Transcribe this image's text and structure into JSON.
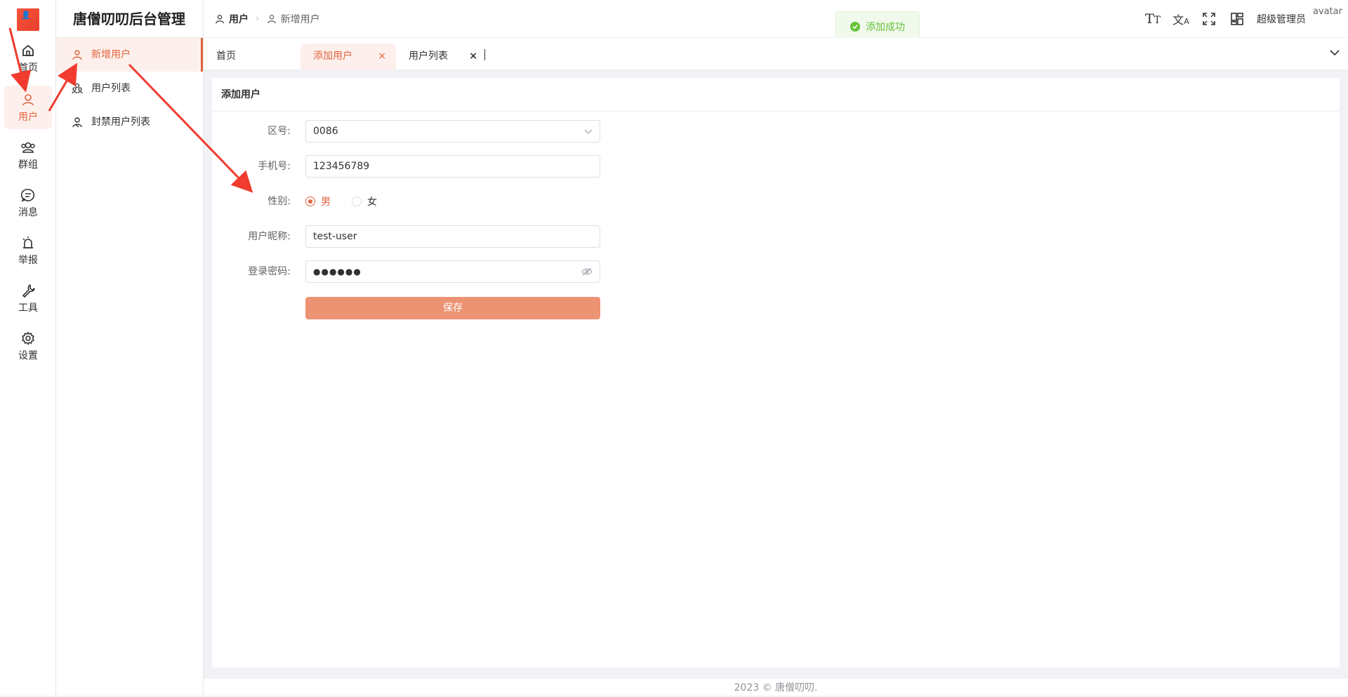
{
  "app": {
    "title": "唐僧叨叨后台管理"
  },
  "rail": {
    "items": [
      {
        "label": "首页",
        "icon": "home-icon"
      },
      {
        "label": "用户",
        "icon": "user-icon"
      },
      {
        "label": "群组",
        "icon": "group-icon"
      },
      {
        "label": "消息",
        "icon": "message-icon"
      },
      {
        "label": "举报",
        "icon": "alarm-icon"
      },
      {
        "label": "工具",
        "icon": "wrench-icon"
      },
      {
        "label": "设置",
        "icon": "gear-icon"
      }
    ]
  },
  "submenu": {
    "items": [
      {
        "label": "新增用户",
        "icon": "user-add-icon"
      },
      {
        "label": "用户列表",
        "icon": "users-icon"
      },
      {
        "label": "封禁用户列表",
        "icon": "user-ban-icon"
      }
    ]
  },
  "breadcrumb": {
    "level1": "用户",
    "level2": "新增用户"
  },
  "header": {
    "user_name": "超级管理员",
    "avatar_alt": "avatar"
  },
  "tabs": [
    {
      "label": "首页"
    },
    {
      "label": "添加用户",
      "close": "×"
    },
    {
      "label": "用户列表",
      "close": "×"
    }
  ],
  "toast": {
    "message": "添加成功"
  },
  "form": {
    "title": "添加用户",
    "area_code": {
      "label": "区号:",
      "value": "0086"
    },
    "phone": {
      "label": "手机号:",
      "value": "123456789"
    },
    "gender": {
      "label": "性别:",
      "options": [
        "男",
        "女"
      ],
      "selected": "男"
    },
    "nickname": {
      "label": "用户昵称:",
      "value": "test-user"
    },
    "password": {
      "label": "登录密码:",
      "value": "●●●●●●"
    },
    "save_label": "保存"
  },
  "footer": {
    "text": "2023 © 唐僧叨叨."
  },
  "colors": {
    "accent": "#e0643d",
    "save_button": "#ec9374",
    "toast_success": "#67c23a"
  }
}
